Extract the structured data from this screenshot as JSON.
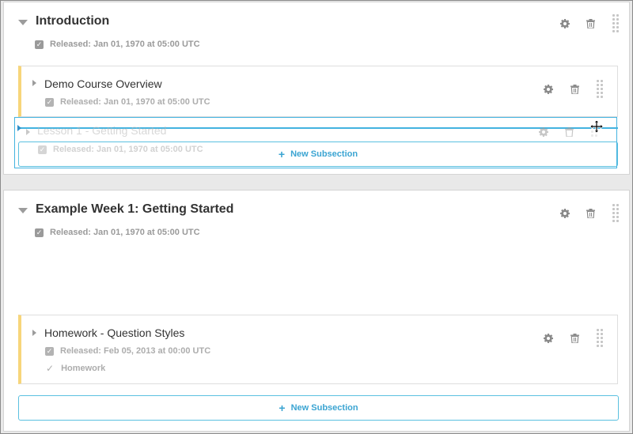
{
  "sections": [
    {
      "title": "Introduction",
      "status": "Released: Jan 01, 1970 at 05:00 UTC",
      "subsections": [
        {
          "title": "Demo Course Overview",
          "status": "Released: Jan 01, 1970 at 05:00 UTC"
        }
      ],
      "dragged_subsection": {
        "title": "Lesson 1 - Getting Started",
        "status": "Released: Jan 01, 1970 at 05:00 UTC"
      },
      "new_subsection_label": "New Subsection"
    },
    {
      "title": "Example Week 1: Getting Started",
      "status": "Released: Jan 01, 1970 at 05:00 UTC",
      "subsections": [
        {
          "title": "Homework - Question Styles",
          "status": "Released: Feb 05, 2013 at 00:00 UTC",
          "grading": "Homework"
        }
      ],
      "new_subsection_label": "New Subsection"
    }
  ],
  "icons": {
    "settings": "gear-icon",
    "delete": "trash-icon",
    "drag": "drag-handle-icon",
    "expand": "caret-icon",
    "move_cursor": "move-cursor-icon",
    "check": "checkmark-icon",
    "add": "plus-icon"
  },
  "colors": {
    "release_bar": "#f7d57a",
    "accent": "#3aa4d2",
    "drop_indicator": "#43b3e0"
  }
}
